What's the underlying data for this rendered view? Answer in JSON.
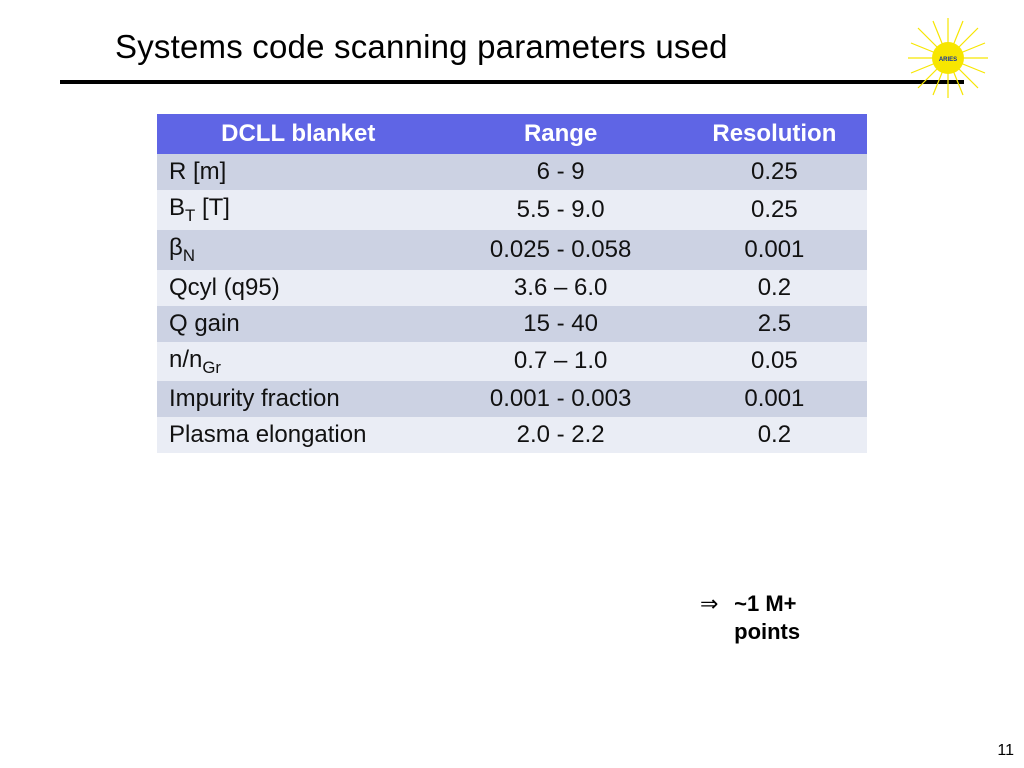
{
  "title": "Systems code scanning parameters used",
  "logo_label": "ARIES",
  "table": {
    "headers": [
      "DCLL blanket",
      "Range",
      "Resolution"
    ],
    "rows": [
      {
        "param_html": "R [m]",
        "range": "6 - 9",
        "res": "0.25"
      },
      {
        "param_html": "B<sub>T</sub> [T]",
        "range": "5.5 - 9.0",
        "res": "0.25"
      },
      {
        "param_html": "β<sub>N</sub>",
        "range": "0.025 - 0.058",
        "res": "0.001"
      },
      {
        "param_html": "Qcyl (q95)",
        "range": "3.6 – 6.0",
        "res": "0.2"
      },
      {
        "param_html": "Q gain",
        "range": "15 - 40",
        "res": "2.5"
      },
      {
        "param_html": "n/n<sub>Gr</sub>",
        "range": "0.7 – 1.0",
        "res": "0.05"
      },
      {
        "param_html": "Impurity fraction",
        "range": "0.001 - 0.003",
        "res": "0.001"
      },
      {
        "param_html": "Plasma elongation",
        "range": "2.0 - 2.2",
        "res": "0.2"
      }
    ]
  },
  "footnote": {
    "arrow": "⇒",
    "line1": "~1 M+",
    "line2": "points"
  },
  "page_number": "11"
}
